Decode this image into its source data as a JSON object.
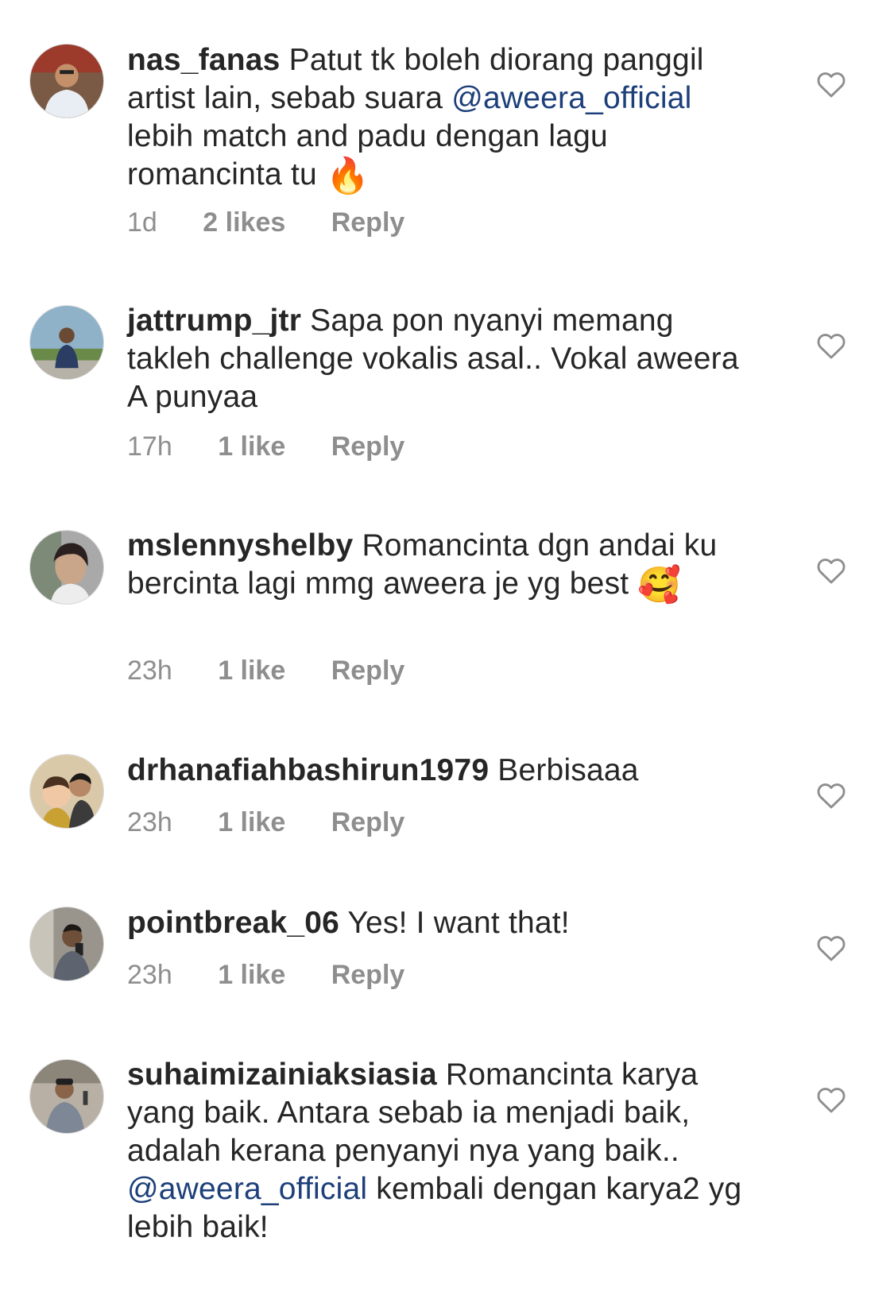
{
  "comments": [
    {
      "username": "nas_fanas",
      "text_1": "Patut tk boleh diorang panggil artist lain, sebab suara",
      "mention": "@aweera_official",
      "text_2": "lebih match and padu dengan lagu romancinta tu",
      "emoji": "🔥",
      "time": "1d",
      "likes": "2 likes",
      "reply": "Reply"
    },
    {
      "username": "jattrump_jtr",
      "text_1": "Sapa pon nyanyi memang takleh challenge vokalis asal.. Vokal aweera A punyaa",
      "time": "17h",
      "likes": "1 like",
      "reply": "Reply"
    },
    {
      "username": "mslennyshelby",
      "text_1": "Romancinta dgn andai ku bercinta lagi mmg aweera je yg best",
      "emoji": "🥰",
      "time": "23h",
      "likes": "1 like",
      "reply": "Reply"
    },
    {
      "username": "drhanafiahbashirun1979",
      "text_1": "Berbisaaa",
      "time": "23h",
      "likes": "1 like",
      "reply": "Reply"
    },
    {
      "username": "pointbreak_06",
      "text_1": "Yes! I want that!",
      "time": "23h",
      "likes": "1 like",
      "reply": "Reply"
    },
    {
      "username": "suhaimizainiaksiasia",
      "text_1": "Romancinta karya yang baik. Antara sebab ia menjadi baik, adalah kerana penyanyi nya yang baik..",
      "mention": "@aweera_official",
      "text_2": "kembali dengan karya2 yg lebih baik!"
    }
  ],
  "icons": {
    "like": "heart-outline-icon",
    "avatar": "avatar"
  },
  "colors": {
    "text": "#262626",
    "meta": "#8e8e8e",
    "mention": "#1d3f7a",
    "heart": "#8e8e8e"
  }
}
